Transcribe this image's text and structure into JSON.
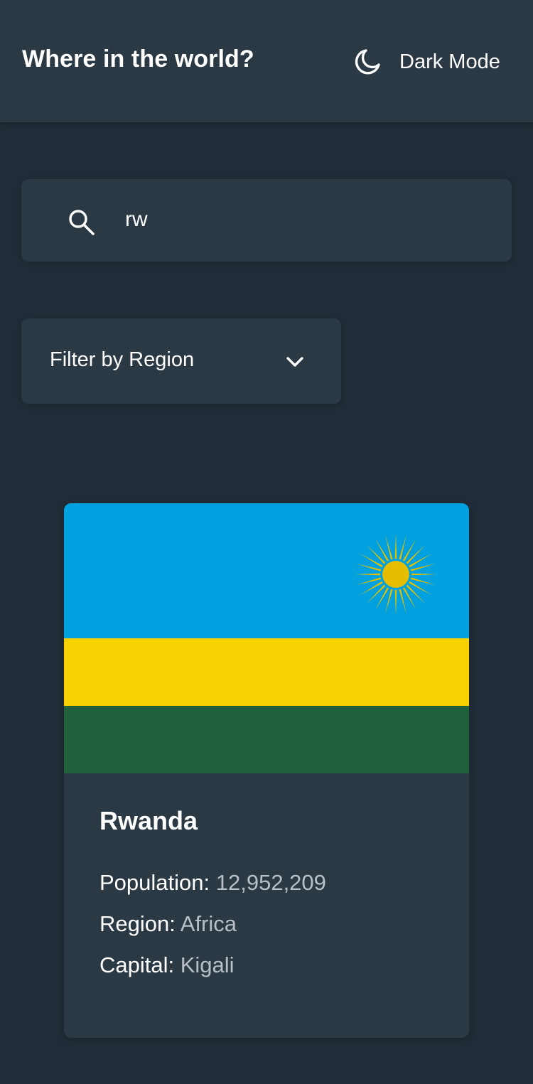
{
  "header": {
    "title": "Where in the world?",
    "theme_toggle_label": "Dark Mode",
    "theme_icon": "moon-icon"
  },
  "search": {
    "value": "rw",
    "icon": "search-icon"
  },
  "filter": {
    "label": "Filter by Region",
    "icon": "chevron-down-icon"
  },
  "countries": [
    {
      "name": "Rwanda",
      "flag": "rwanda-flag",
      "population_label": "Population:",
      "population": "12,952,209",
      "region_label": "Region:",
      "region": "Africa",
      "capital_label": "Capital:",
      "capital": "Kigali"
    }
  ],
  "colors": {
    "background": "#202c37",
    "elements": "#2b3945",
    "text": "#ffffff",
    "muted_text": "#b8bfc6",
    "flag_blue": "#00a1de",
    "flag_yellow": "#fad201",
    "flag_green": "#20603d",
    "flag_sun": "#e5be01"
  }
}
